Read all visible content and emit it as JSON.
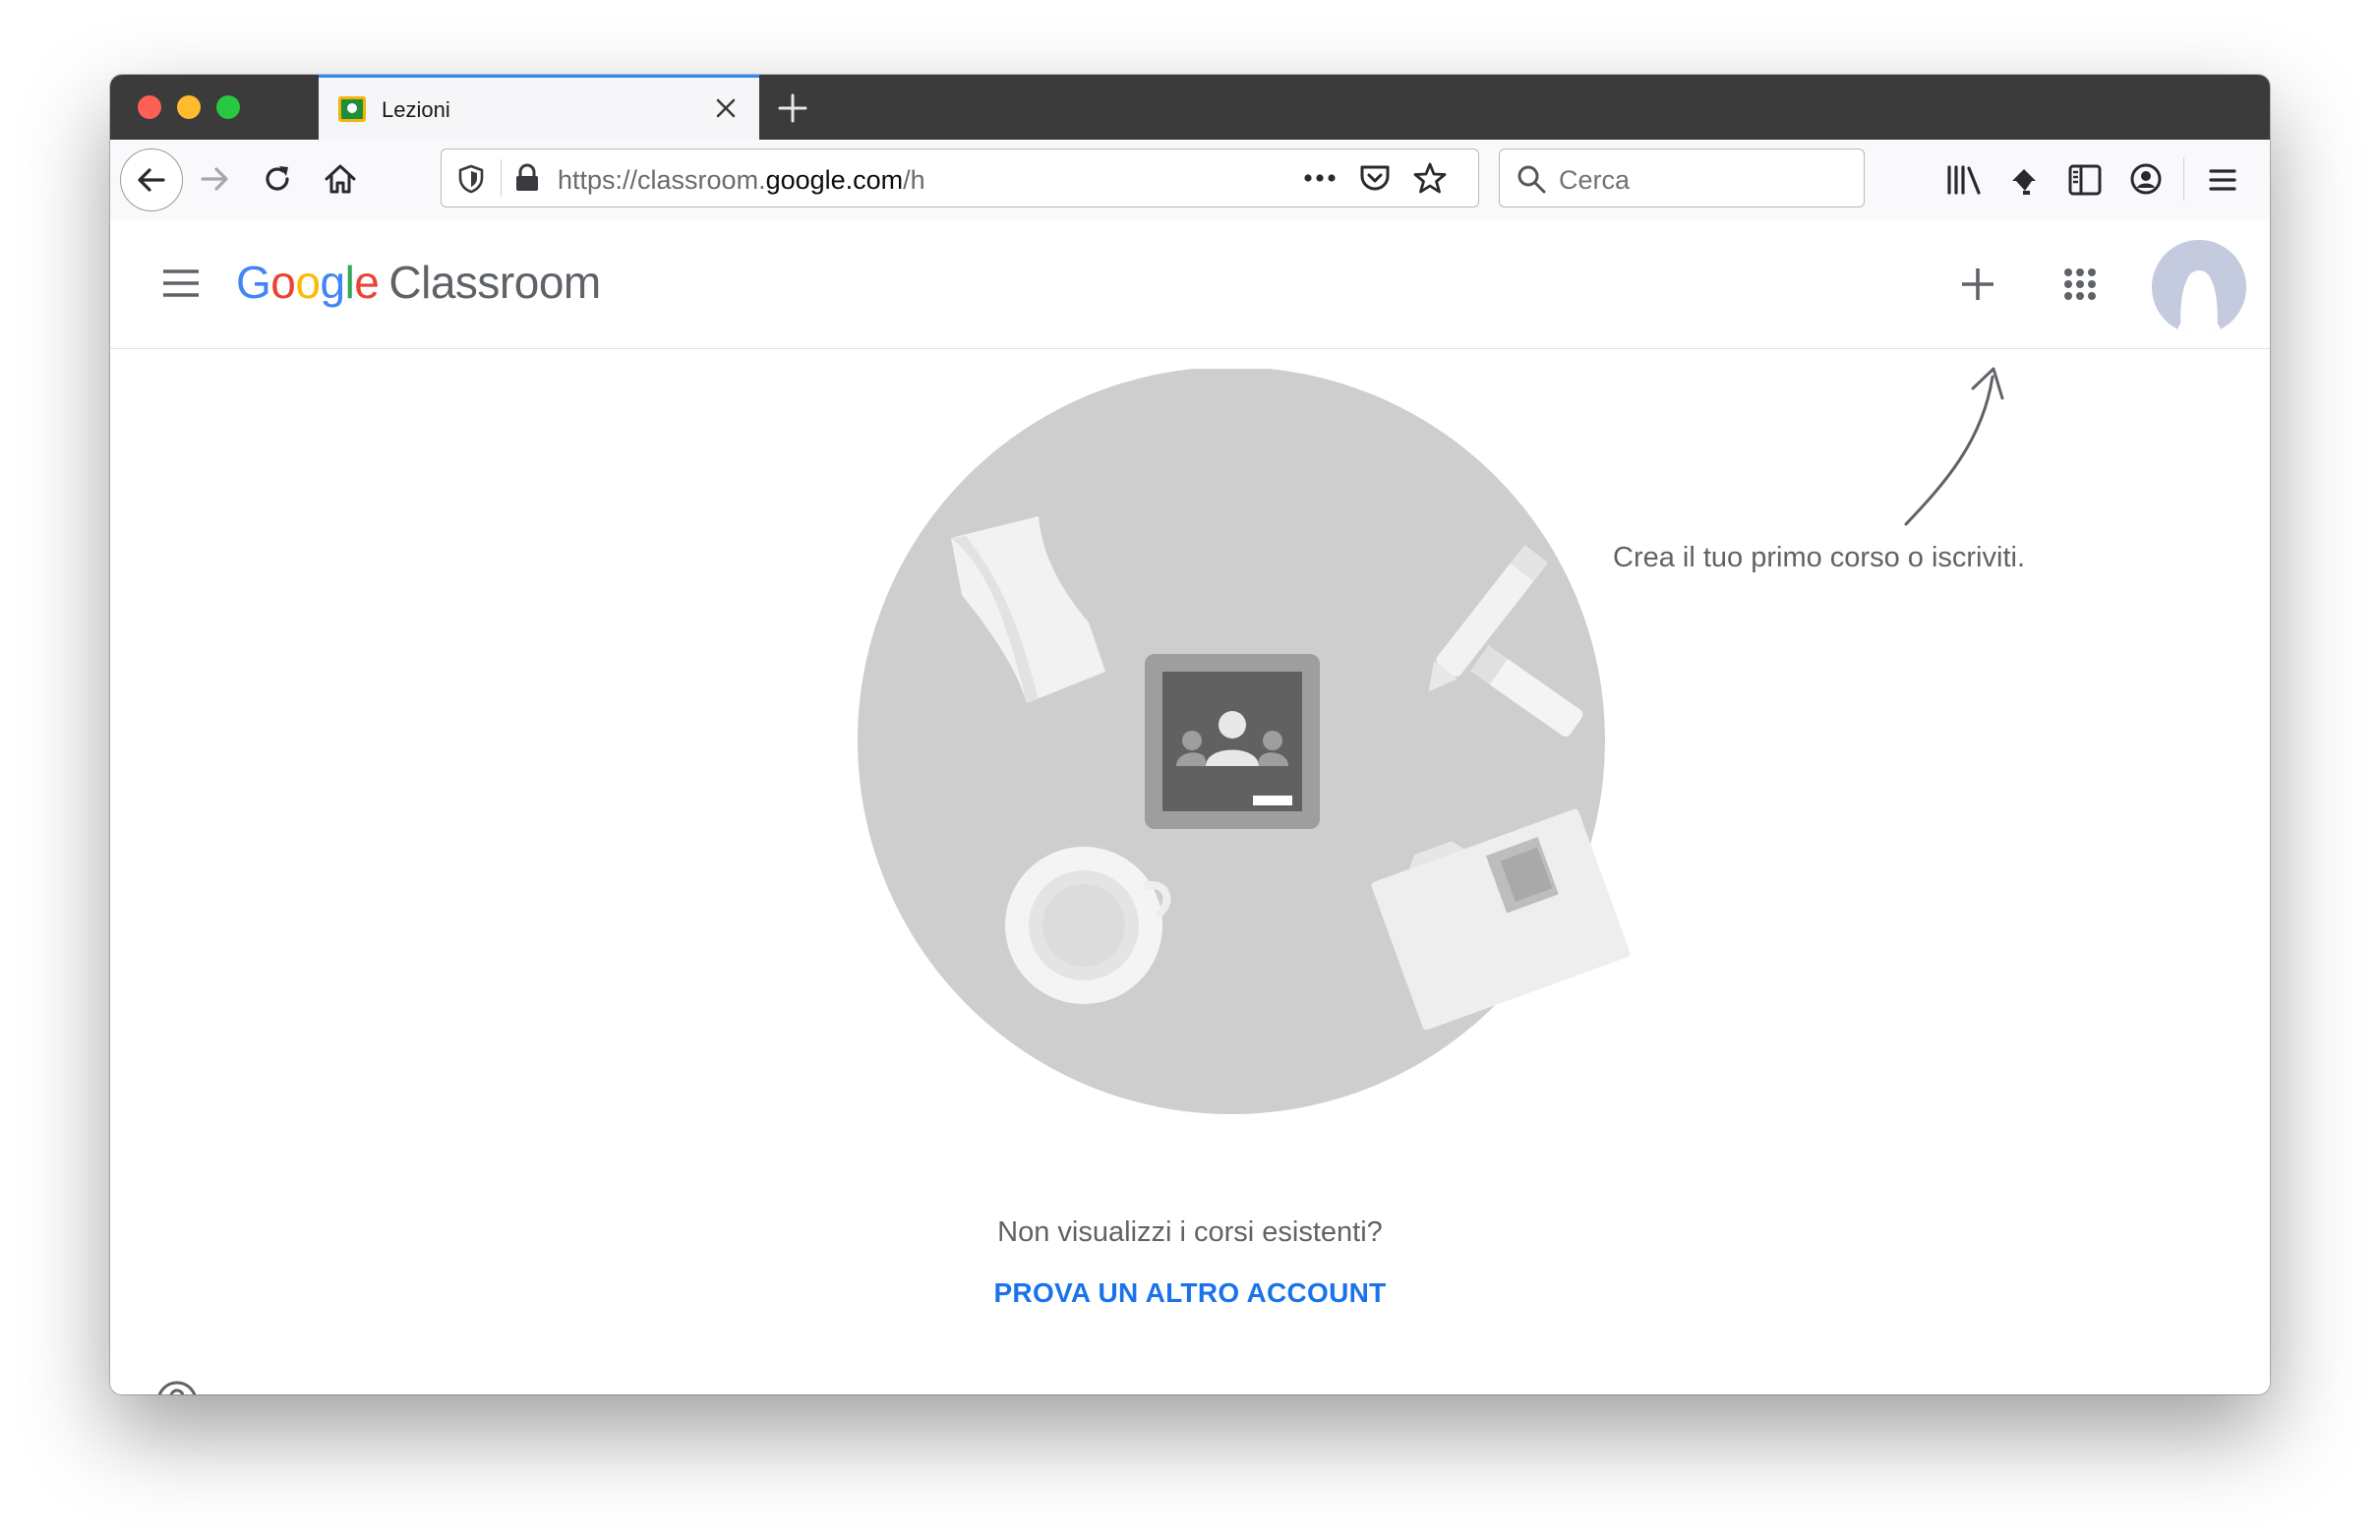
{
  "window": {
    "tab": {
      "title": "Lezioni"
    },
    "colors": {
      "close": "#fe5f57",
      "minimize": "#febc2e",
      "zoom": "#28c840",
      "tab_accent": "#2c8cf3"
    }
  },
  "browser": {
    "url": {
      "prefix": "https://classroom.",
      "domain": "google.com",
      "path": "/h"
    },
    "search_placeholder": "Cerca"
  },
  "app": {
    "logo": {
      "google": [
        "G",
        "o",
        "o",
        "g",
        "l",
        "e"
      ],
      "product": "Classroom"
    },
    "hint": "Crea il tuo primo corso o iscriviti.",
    "empty_title": "Non visualizzi i corsi esistenti?",
    "try_other_account": "PROVA UN ALTRO ACCOUNT",
    "colors": {
      "blue": "#4285f4",
      "red": "#ea4335",
      "yellow": "#fbbc05",
      "green": "#34a853",
      "link": "#1a73e8"
    }
  }
}
